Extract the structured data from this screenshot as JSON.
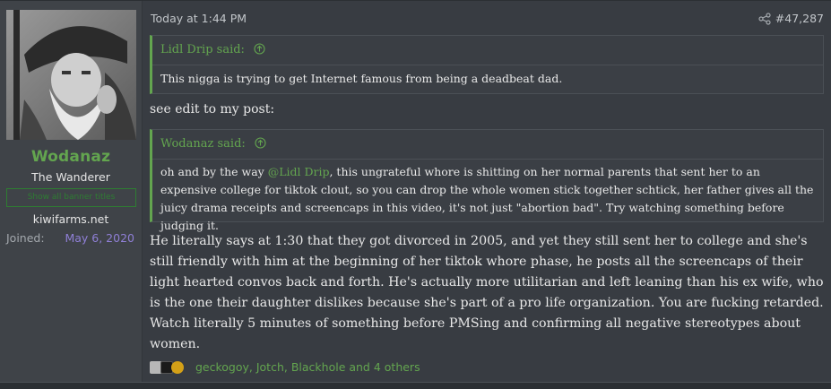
{
  "user": {
    "name": "Wodanaz",
    "title": "The Wanderer",
    "banner": "Show all banner titles",
    "site": "kiwifarms.net",
    "joined_label": "Joined:",
    "joined_value": "May 6, 2020",
    "avatar_icon": "bearded-wanderer-avatar"
  },
  "post": {
    "timestamp": "Today at 1:44 PM",
    "number": "#47,287",
    "share_icon": "share-icon",
    "quote1": {
      "author": "Lidl Drip said:",
      "text": "This nigga is trying to get Internet famous from being a deadbeat dad."
    },
    "see_edit": "see edit to my post:",
    "quote2": {
      "author": "Wodanaz said:",
      "text_before": "oh and by the way ",
      "mention": "@Lidl Drip",
      "text_after": ", this ungrateful whore is shitting on her normal parents that sent her to an expensive college for tiktok clout, so you can drop the whole women stick together schtick, her father gives all the juicy drama receipts and screencaps in this video, it's not just \"abortion bad\". Try watching something before judging it."
    },
    "body": "He literally says at 1:30 that they got divorced in 2005, and yet they still sent her to college and she's still friendly with him at the beginning of her tiktok whore phase, he posts all the screencaps of their light hearted convos back and forth. He's actually more utilitarian and left leaning than his ex wife, who is the one their daughter dislikes because she's part of a pro life organization. You are fucking retarded. Watch literally 5 minutes of something before PMSing and confirming all negative stereotypes about women.",
    "reactions": "geckogoy, Jotch, Blackhole and 4 others"
  },
  "colors": {
    "accent": "#63a54f",
    "joined": "#8f7fd6",
    "post_bg": "#383c42",
    "sidebar_bg": "#3f4348"
  }
}
